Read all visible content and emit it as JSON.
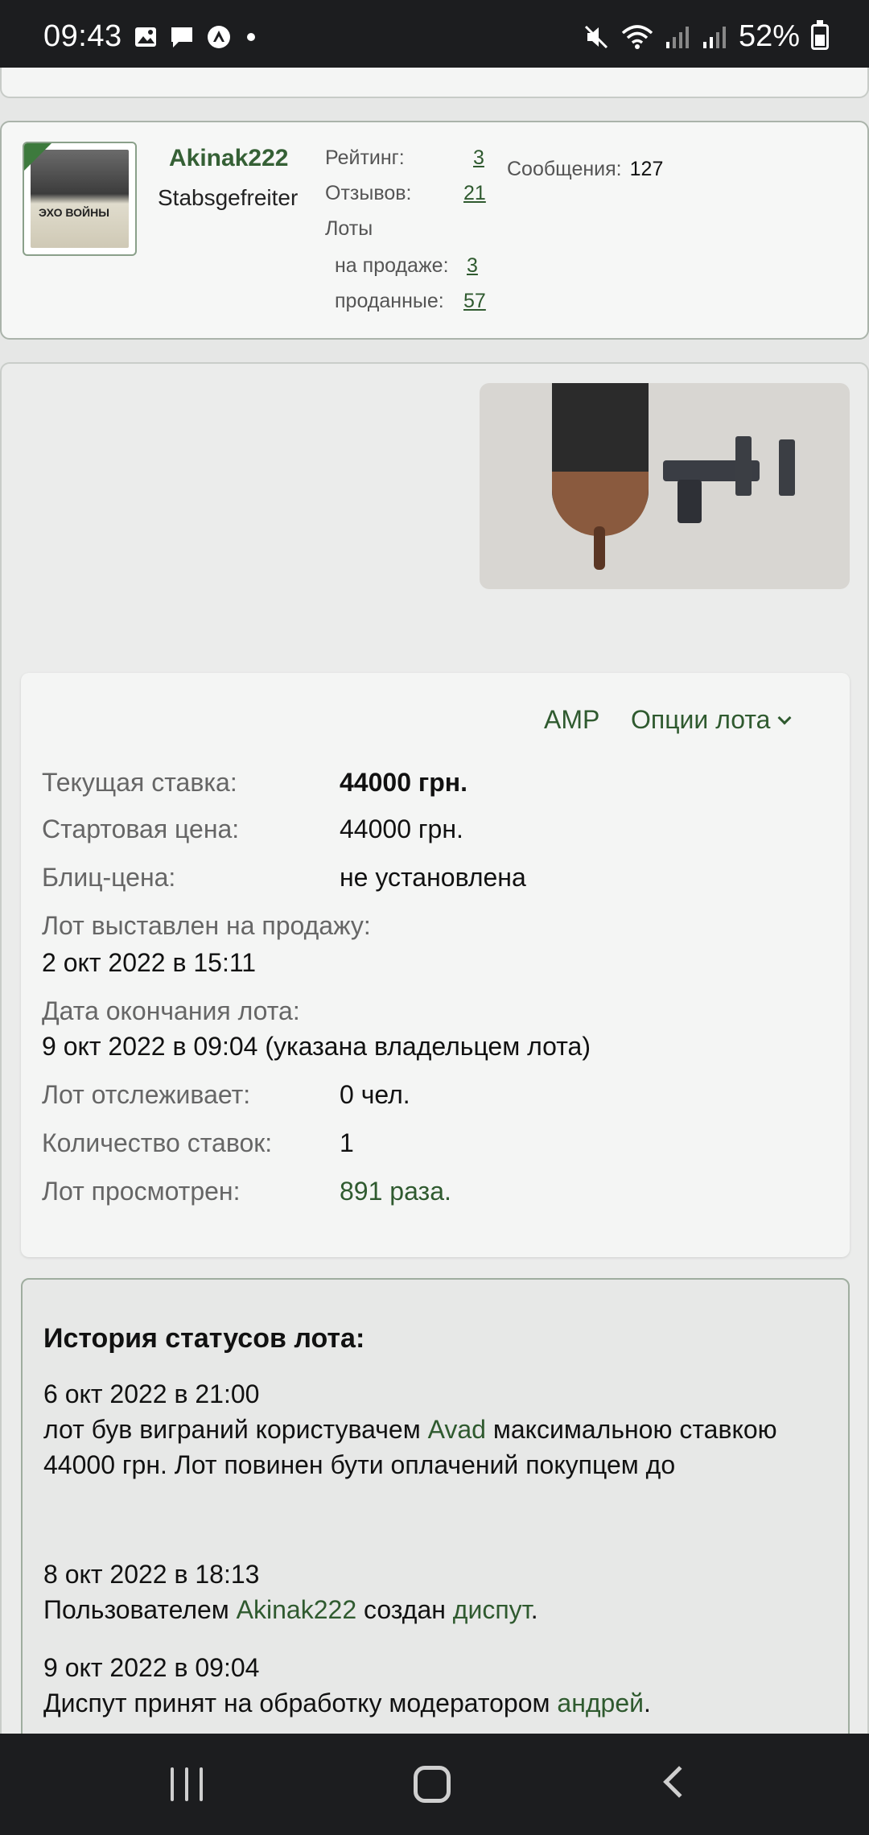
{
  "status_bar": {
    "time": "09:43",
    "battery": "52%",
    "battery_level": 0.52,
    "left_icons": [
      "image-icon",
      "chat-icon",
      "app-icon",
      "dot-icon"
    ],
    "right_icons": [
      "mute-icon",
      "wifi-icon",
      "signal-icon",
      "signal-icon"
    ]
  },
  "seller": {
    "name": "Akinak222",
    "rank": "Stabsgefreiter",
    "rating_label": "Рейтинг:",
    "rating_value": "3",
    "reviews_label": "Отзывов:",
    "reviews_value": "21",
    "lots_label": "Лоты",
    "on_sale_label": "на продаже:",
    "on_sale_value": "3",
    "sold_label": "проданные:",
    "sold_value": "57",
    "messages_label": "Сообщения:",
    "messages_value": "127",
    "avatar_text": "ЭХО ВОЙНЫ"
  },
  "lot": {
    "amp_label": "AMP",
    "options_label": "Опции лота",
    "current_bid_label": "Текущая ставка:",
    "current_bid_value": "44000 грн.",
    "start_price_label": "Стартовая цена:",
    "start_price_value": "44000 грн.",
    "blitz_label": "Блиц-цена:",
    "blitz_value": "не установлена",
    "listed_label": "Лот выставлен на продажу:",
    "listed_value": "2 окт 2022 в 15:11",
    "end_label": "Дата окончания лота:",
    "end_value": "9 окт 2022 в 09:04 (указана владельцем лота)",
    "watchers_label": "Лот отслеживает:",
    "watchers_value": "0 чел.",
    "bids_label": "Количество ставок:",
    "bids_value": "1",
    "views_label": "Лот просмотрен:",
    "views_value": "891 раза."
  },
  "history": {
    "title": "История статусов лота:",
    "items": [
      {
        "date": "6 окт 2022 в 21:00",
        "text_before": "лот був виграний користувачем ",
        "user": "Avad",
        "text_after": " максимальною ставкою 44000 грн. Лот повинен бути оплачений покупцем до"
      },
      {
        "date": "8 окт 2022 в 18:13",
        "text_before": "Пользователем ",
        "user": "Akinak222",
        "text_middle": " создан ",
        "link": "диспут",
        "text_after": "."
      },
      {
        "date": "9 окт 2022 в 09:04",
        "text_before": "Диспут принят на обработку модератором ",
        "user": "андрей",
        "text_after": "."
      }
    ]
  }
}
